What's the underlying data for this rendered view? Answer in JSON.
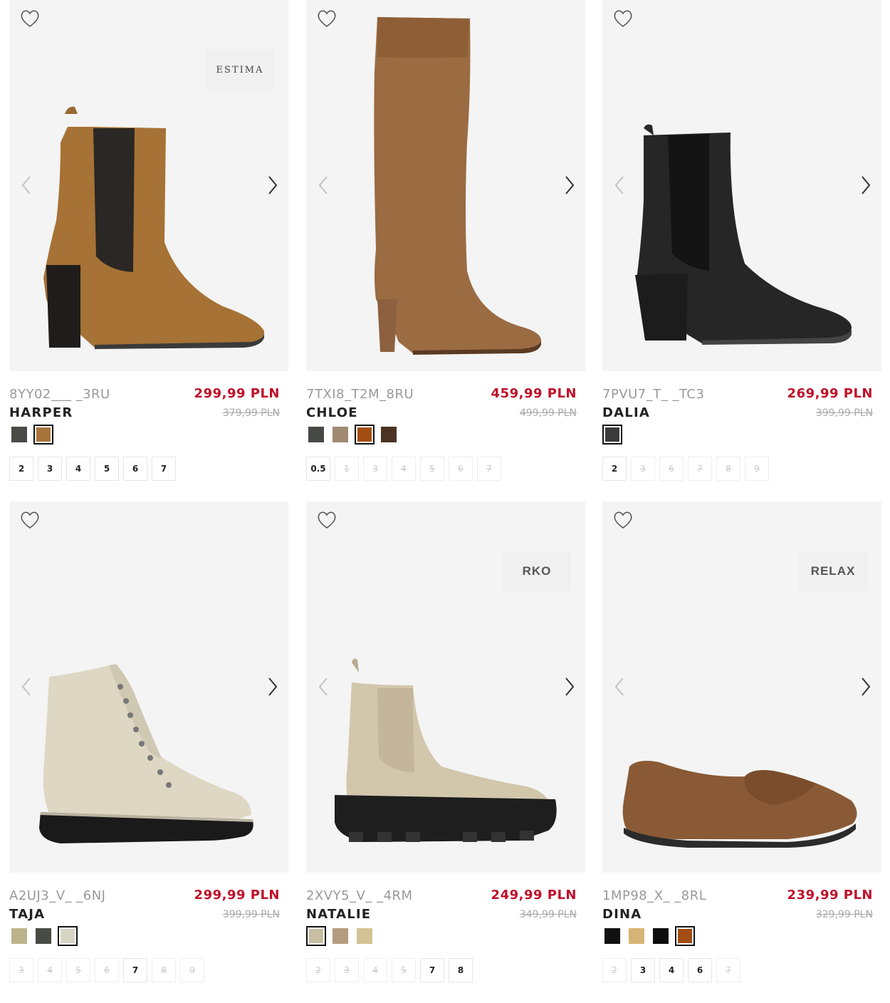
{
  "products": [
    {
      "sku": "8YY02___ _3RU",
      "name": "HARPER",
      "price": "299,99 PLN",
      "old_price": "379,99 PLN",
      "brand": "ESTIMA",
      "image": "suede-chelsea-heel-boot",
      "colors": [
        {
          "hex": "#4a4a46",
          "selected": false
        },
        {
          "hex": "#a8743a",
          "selected": true
        }
      ],
      "sizes": [
        {
          "label": "2",
          "available": true
        },
        {
          "label": "3",
          "available": true
        },
        {
          "label": "4",
          "available": true
        },
        {
          "label": "5",
          "available": true
        },
        {
          "label": "6",
          "available": true
        },
        {
          "label": "7",
          "available": true
        }
      ]
    },
    {
      "sku": "7TXI8_T2M_8RU",
      "name": "CHLOE",
      "price": "459,99 PLN",
      "old_price": "499,99 PLN",
      "brand": "",
      "image": "knee-high-leather-boot",
      "colors": [
        {
          "hex": "#474a44",
          "selected": false
        },
        {
          "hex": "#a08a72",
          "selected": false
        },
        {
          "hex": "#a34d12",
          "selected": true
        },
        {
          "hex": "#4a3324",
          "selected": false
        }
      ],
      "sizes": [
        {
          "label": "0.5",
          "available": true
        },
        {
          "label": "1",
          "available": false
        },
        {
          "label": "3",
          "available": false
        },
        {
          "label": "4",
          "available": false
        },
        {
          "label": "5",
          "available": false
        },
        {
          "label": "6",
          "available": false
        },
        {
          "label": "7",
          "available": false
        }
      ]
    },
    {
      "sku": "7PVU7_T_ _TC3",
      "name": "DALIA",
      "price": "269,99 PLN",
      "old_price": "399,99 PLN",
      "brand": "",
      "image": "black-chelsea-heel-boot",
      "colors": [
        {
          "hex": "#3a3a3a",
          "selected": true
        }
      ],
      "sizes": [
        {
          "label": "2",
          "available": true
        },
        {
          "label": "3",
          "available": false
        },
        {
          "label": "6",
          "available": false
        },
        {
          "label": "7",
          "available": false
        },
        {
          "label": "8",
          "available": false
        },
        {
          "label": "9",
          "available": false
        }
      ]
    },
    {
      "sku": "A2UJ3_V_ _6NJ",
      "name": "TAJA",
      "price": "299,99 PLN",
      "old_price": "399,99 PLN",
      "brand": "",
      "image": "cream-lace-up-boot",
      "colors": [
        {
          "hex": "#bdb38a",
          "selected": false
        },
        {
          "hex": "#484a44",
          "selected": false
        },
        {
          "hex": "#d8d4c4",
          "selected": true
        }
      ],
      "sizes": [
        {
          "label": "3",
          "available": false
        },
        {
          "label": "4",
          "available": false
        },
        {
          "label": "5",
          "available": false
        },
        {
          "label": "6",
          "available": false
        },
        {
          "label": "7",
          "available": true
        },
        {
          "label": "8",
          "available": false
        },
        {
          "label": "9",
          "available": false
        }
      ]
    },
    {
      "sku": "2XVY5_V_ _4RM",
      "name": "NATALIE",
      "price": "249,99 PLN",
      "old_price": "349,99 PLN",
      "brand": "RKO",
      "image": "beige-chunky-chelsea-boot",
      "colors": [
        {
          "hex": "#c8bfa3",
          "selected": true
        },
        {
          "hex": "#b59b7f",
          "selected": false
        },
        {
          "hex": "#d2c394",
          "selected": false
        }
      ],
      "sizes": [
        {
          "label": "2",
          "available": false
        },
        {
          "label": "3",
          "available": false
        },
        {
          "label": "4",
          "available": false
        },
        {
          "label": "5",
          "available": false
        },
        {
          "label": "7",
          "available": true
        },
        {
          "label": "8",
          "available": true
        }
      ]
    },
    {
      "sku": "1MP98_X_ _8RL",
      "name": "DINA",
      "price": "239,99 PLN",
      "old_price": "329,99 PLN",
      "brand": "RELAX",
      "image": "brown-penny-loafer",
      "colors": [
        {
          "hex": "#111111",
          "selected": false
        },
        {
          "hex": "#d6b476",
          "selected": false
        },
        {
          "hex": "#0d0d0d",
          "selected": false
        },
        {
          "hex": "#a34d12",
          "selected": true
        }
      ],
      "sizes": [
        {
          "label": "2",
          "available": false
        },
        {
          "label": "3",
          "available": true
        },
        {
          "label": "4",
          "available": true
        },
        {
          "label": "6",
          "available": true
        },
        {
          "label": "7",
          "available": false
        }
      ]
    }
  ]
}
